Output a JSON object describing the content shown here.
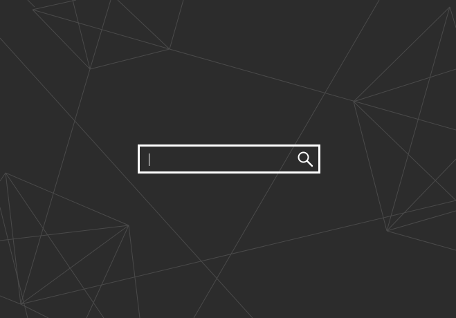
{
  "search": {
    "value": "",
    "placeholder": "",
    "button_icon": "search-icon"
  },
  "colors": {
    "background": "#2c2c2c",
    "line": "#4a4a4a",
    "box_border": "#ffffff"
  }
}
